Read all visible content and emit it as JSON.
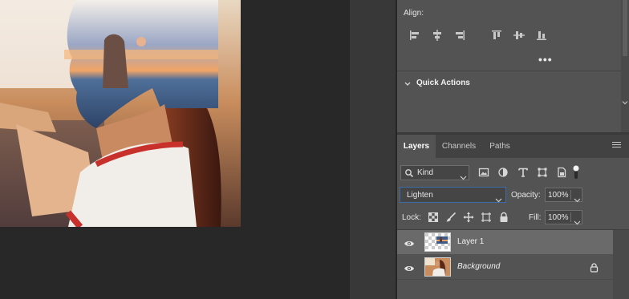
{
  "properties": {
    "align_label": "Align:",
    "more_label": "•••",
    "quick_actions_label": "Quick Actions",
    "align_buttons": [
      "align-left-edges",
      "align-horizontal-centers",
      "align-right-edges",
      "align-top-edges",
      "align-vertical-centers",
      "align-bottom-edges"
    ]
  },
  "layers_panel": {
    "tabs": [
      {
        "label": "Layers",
        "active": true
      },
      {
        "label": "Channels",
        "active": false
      },
      {
        "label": "Paths",
        "active": false
      }
    ],
    "filter": {
      "kind_label": "Kind",
      "icons": [
        "pixel-filter-icon",
        "adjustment-filter-icon",
        "type-filter-icon",
        "shape-filter-icon",
        "smart-object-filter-icon"
      ]
    },
    "blend_mode": "Lighten",
    "opacity_label": "Opacity:",
    "opacity_value": "100%",
    "lock_label": "Lock:",
    "lock_icons": [
      "lock-transparent-pixels-icon",
      "lock-image-pixels-icon",
      "lock-position-icon",
      "prevent-auto-nesting-icon",
      "lock-all-icon"
    ],
    "fill_label": "Fill:",
    "fill_value": "100%",
    "layers": [
      {
        "name": "Layer 1",
        "visible": true,
        "selected": true,
        "locked": false
      },
      {
        "name": "Background",
        "visible": true,
        "selected": false,
        "locked": true
      }
    ]
  },
  "colors": {
    "accent": "#3b6ea8",
    "panel": "#535353",
    "workspace": "#282828",
    "selected_layer": "#6a6a6a"
  }
}
